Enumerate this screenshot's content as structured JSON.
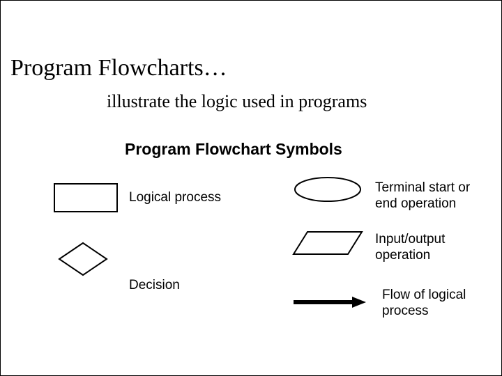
{
  "title": "Program Flowcharts…",
  "subtitle": "illustrate the logic used in programs",
  "section_heading": "Program Flowchart Symbols",
  "symbols": {
    "rectangle": {
      "label": "Logical process"
    },
    "diamond": {
      "label": "Decision"
    },
    "ellipse": {
      "label": "Terminal start or end operation"
    },
    "parallelogram": {
      "label": "Input/output operation"
    },
    "arrow": {
      "label": "Flow of logical process"
    }
  }
}
